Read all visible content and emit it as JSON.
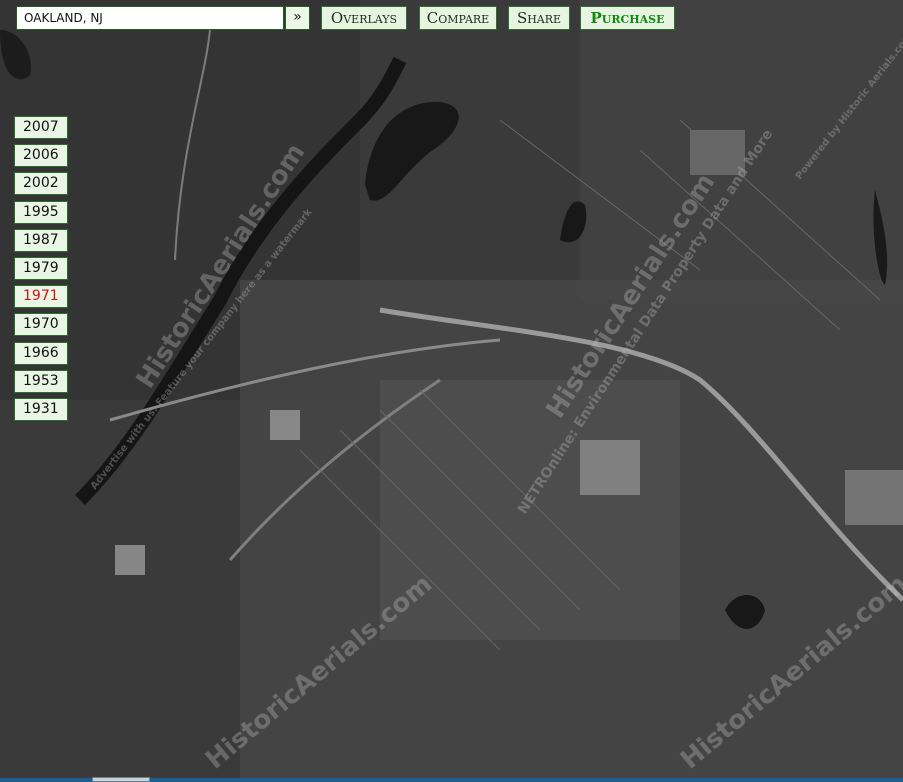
{
  "search": {
    "value": "OAKLAND, NJ",
    "go_label": "»"
  },
  "toolbar": {
    "overlays_label": "Overlays",
    "compare_label": "Compare",
    "share_label": "Share",
    "purchase_label": "Purchase"
  },
  "years": [
    {
      "label": "2007",
      "active": false
    },
    {
      "label": "2006",
      "active": false
    },
    {
      "label": "2002",
      "active": false
    },
    {
      "label": "1995",
      "active": false
    },
    {
      "label": "1987",
      "active": false
    },
    {
      "label": "1979",
      "active": false
    },
    {
      "label": "1971",
      "active": true
    },
    {
      "label": "1970",
      "active": false
    },
    {
      "label": "1966",
      "active": false
    },
    {
      "label": "1953",
      "active": false
    },
    {
      "label": "1931",
      "active": false
    }
  ],
  "watermarks": [
    "HistoricAerials.com",
    "NETROnline: Environmental Data Property Data and More",
    "Advertise with us. Feature your company here as a watermark",
    "Powered by Historic Aerials.com"
  ],
  "colors": {
    "button_bg": "#e6f4e1",
    "button_border": "#2e6e2e",
    "active_year": "#d01414",
    "purchase": "#0f8a0f"
  }
}
